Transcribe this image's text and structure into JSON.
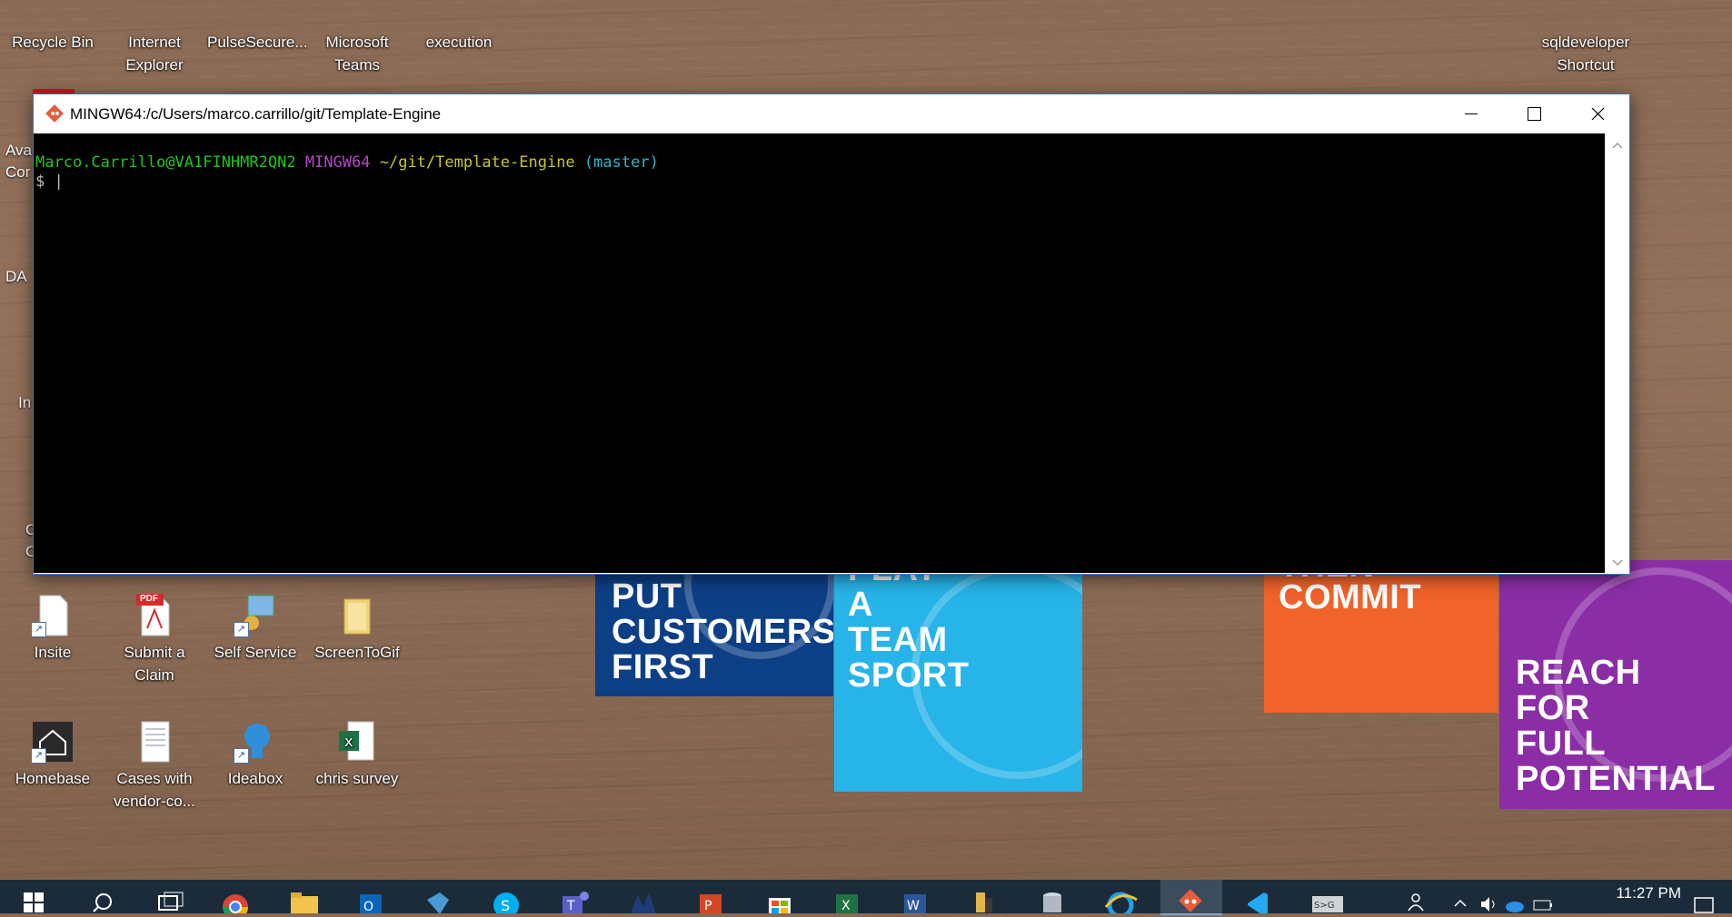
{
  "desktop": {
    "icons_top": [
      {
        "label": "Recycle Bin"
      },
      {
        "label": "Internet Explorer"
      },
      {
        "label": "PulseSecure..."
      },
      {
        "label": "Microsoft Teams"
      },
      {
        "label": "execution"
      },
      {
        "label": "sqldeveloper Shortcut"
      }
    ],
    "icons_partial_left": [
      "Ava",
      "Cor",
      "DA",
      "In",
      "C",
      "C"
    ],
    "icons_row2": [
      {
        "label": "Insite"
      },
      {
        "label": "Submit a Claim"
      },
      {
        "label": "Self Service"
      },
      {
        "label": "ScreenToGif"
      }
    ],
    "icons_row3": [
      {
        "label": "Homebase"
      },
      {
        "label": "Cases with vendor-co..."
      },
      {
        "label": "Ideabox"
      },
      {
        "label": "chris survey"
      }
    ],
    "pdf_badge": "PDF"
  },
  "tiles": [
    {
      "text": "PUT\nCUSTOMERS\nFIRST",
      "color": "#0d3f86"
    },
    {
      "text": "A\nTEAM\nSPORT",
      "partial_text": "PLAY",
      "color": "#27b4e8"
    },
    {
      "text": "COMMIT",
      "partial_text": "THEN",
      "color": "#f0632a"
    },
    {
      "text": "REACH\nFOR\nFULL\nPOTENTIAL",
      "color": "#8b2ea6"
    }
  ],
  "terminal": {
    "title": "MINGW64:/c/Users/marco.carrillo/git/Template-Engine",
    "prompt_user": "Marco.Carrillo@VA1FINHMR2QN2",
    "prompt_env": "MINGW64",
    "prompt_path": "~/git/Template-Engine",
    "prompt_branch": "(master)",
    "prompt_symbol": "$ |",
    "colors": {
      "user": "#1fc41f",
      "env": "#b548c6",
      "path": "#c7c72b",
      "branch": "#2fb5c9"
    }
  },
  "taskbar": {
    "clock": "11:27 PM",
    "apps": [
      "start",
      "search",
      "task-view",
      "chrome",
      "file-explorer",
      "outlook",
      "pulse",
      "skype",
      "teams",
      "dynamics",
      "powerpoint",
      "store",
      "excel",
      "word",
      "tools",
      "database",
      "internet-explorer",
      "git-bash",
      "vscode",
      "sql"
    ]
  }
}
